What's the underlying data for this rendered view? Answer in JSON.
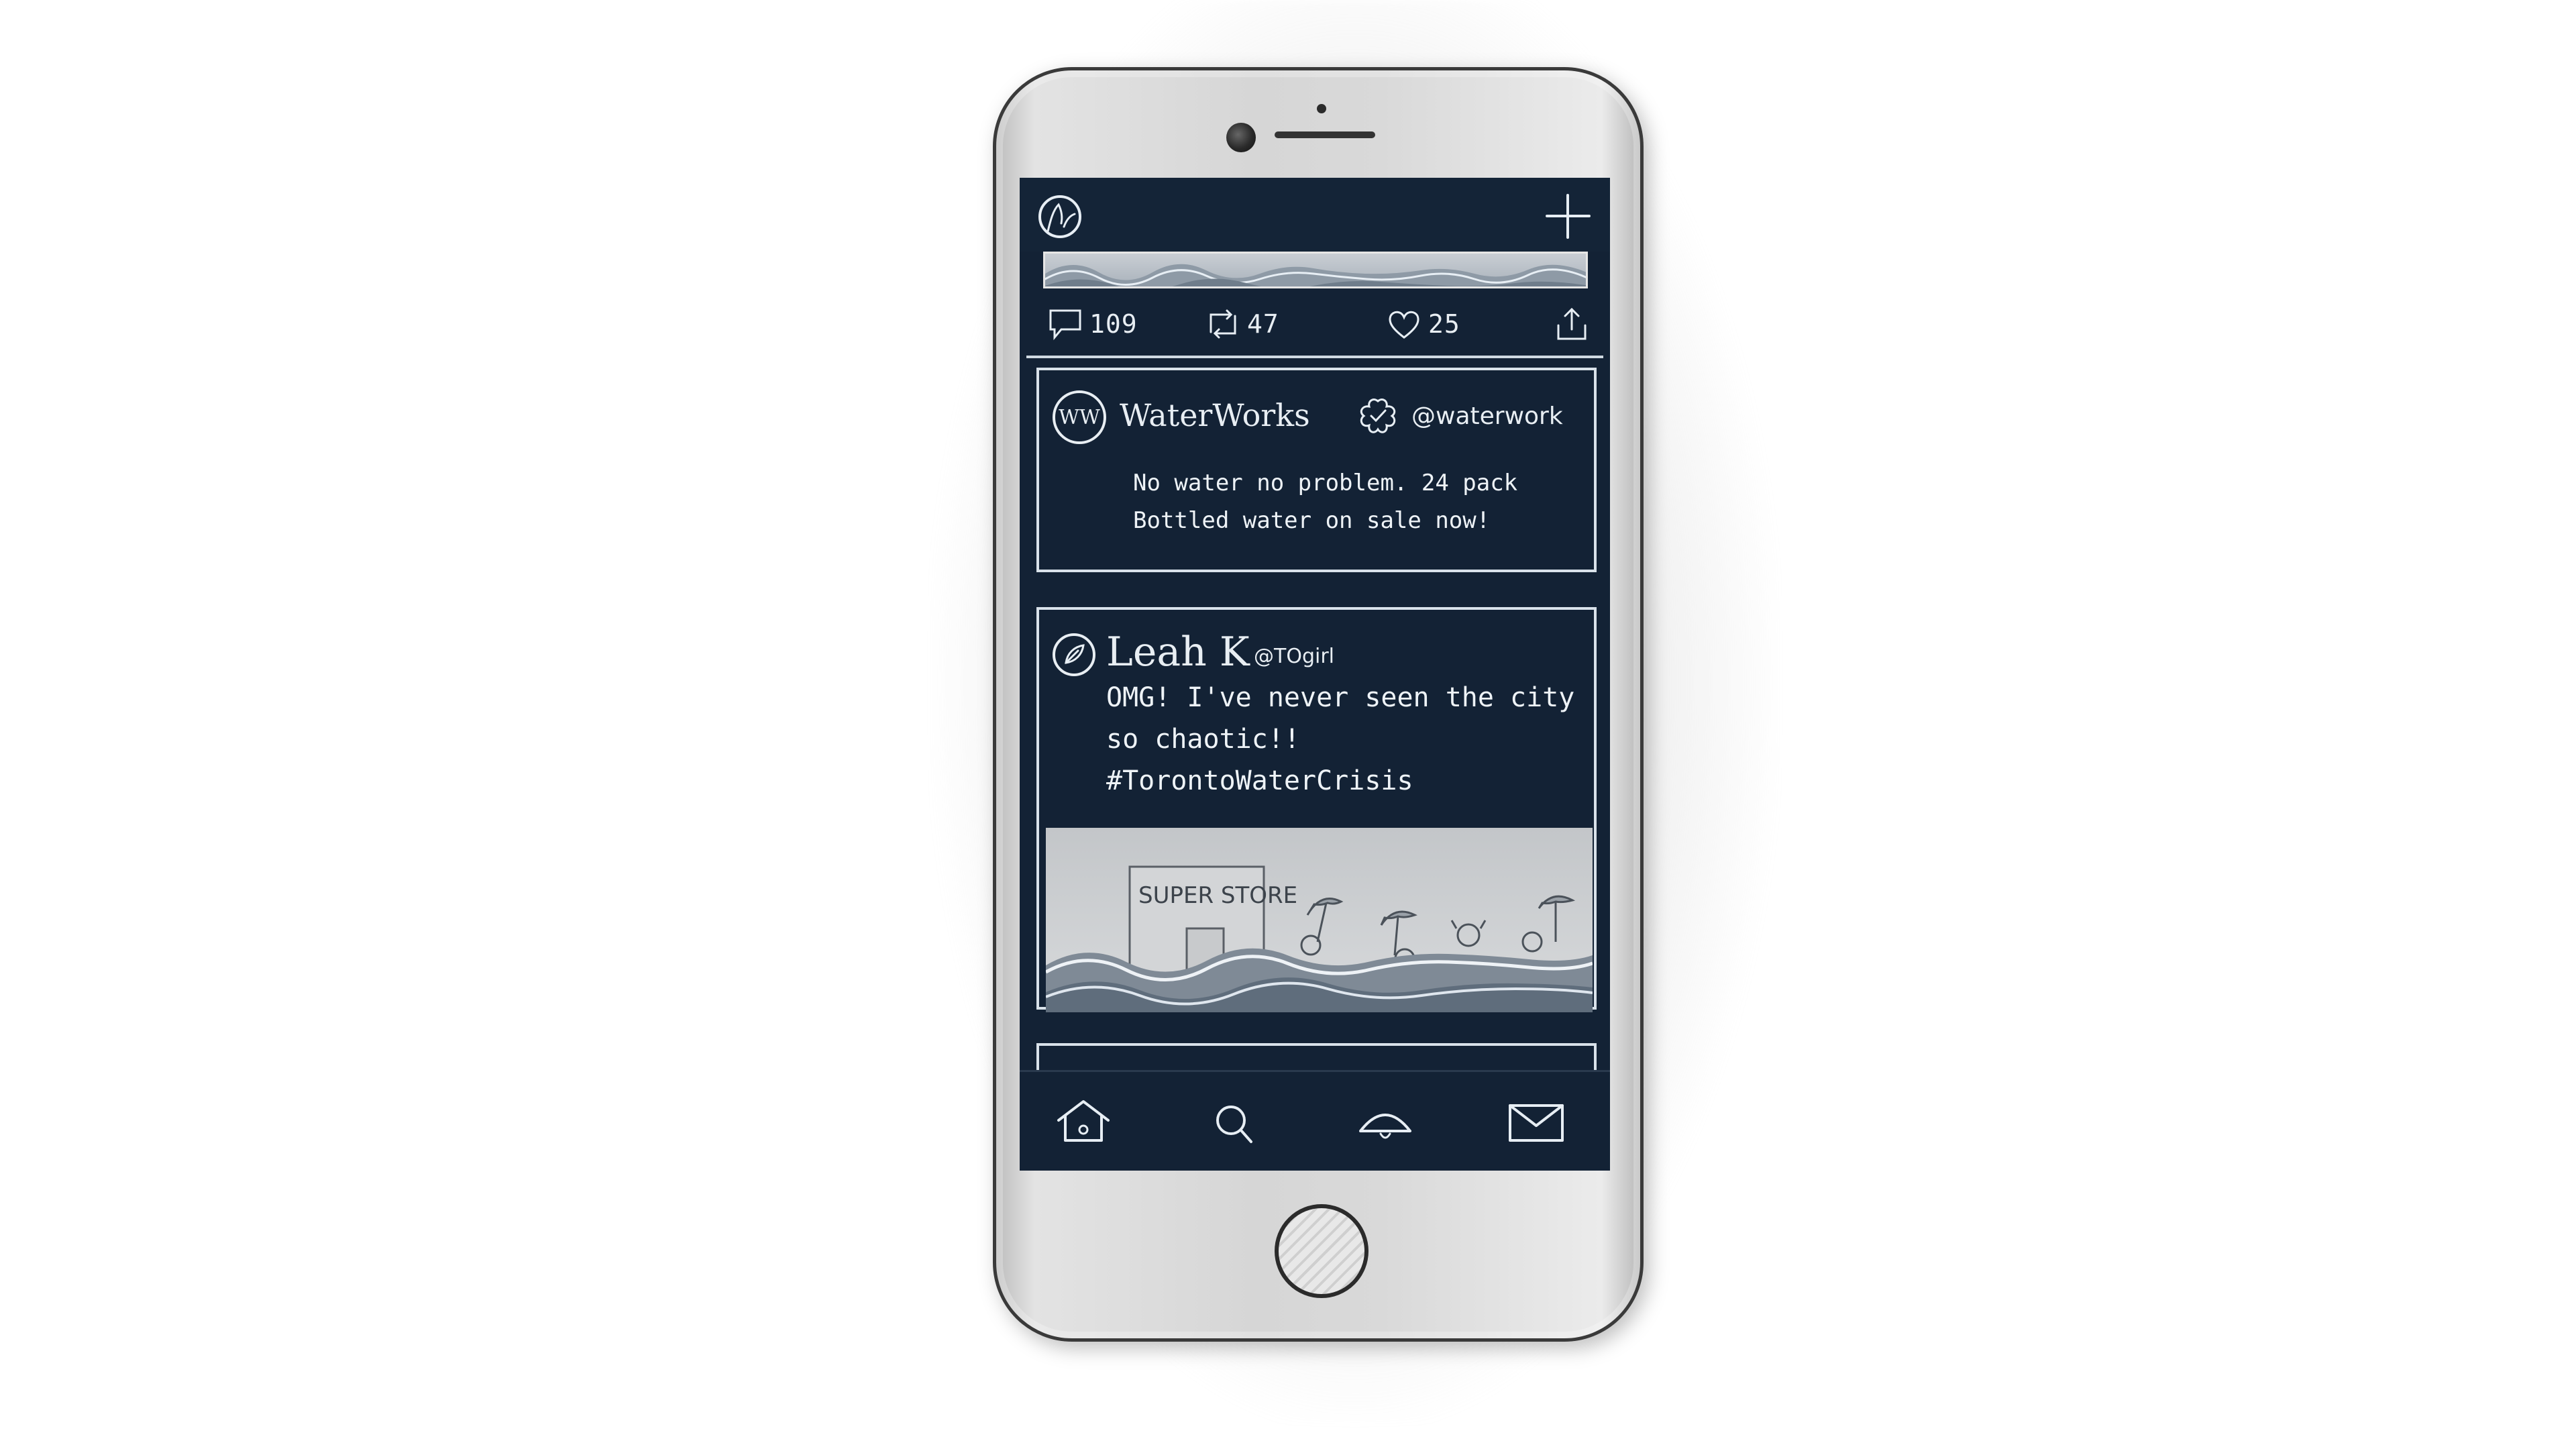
{
  "screen": {
    "background": "#132235",
    "foreground": "#e8eef3"
  },
  "top_bar": {
    "profile_icon": "profile-icon",
    "compose_icon": "plus-icon"
  },
  "previous_tweet_actions": {
    "replies": "109",
    "retweets": "47",
    "likes": "25",
    "icons": [
      "reply-icon",
      "retweet-icon",
      "heart-icon",
      "share-icon"
    ]
  },
  "tweets": [
    {
      "avatar_text": "WW",
      "name": "WaterWorks",
      "verified_icon": "badge-icon",
      "handle": "@waterwork",
      "text": "No water no problem. 24 pack\nBottled water on sale now!"
    },
    {
      "avatar_icon": "leaf-icon",
      "name": "Leah K",
      "handle": "@TOgirl",
      "text": "OMG! I've  never seen the  city\nso chaotic!!\n#TorontoWaterCrisis",
      "image": {
        "sign_text": "SUPER STORE"
      }
    }
  ],
  "tab_bar": {
    "items": [
      "home-icon",
      "search-icon",
      "notifications-icon",
      "messages-icon"
    ]
  }
}
